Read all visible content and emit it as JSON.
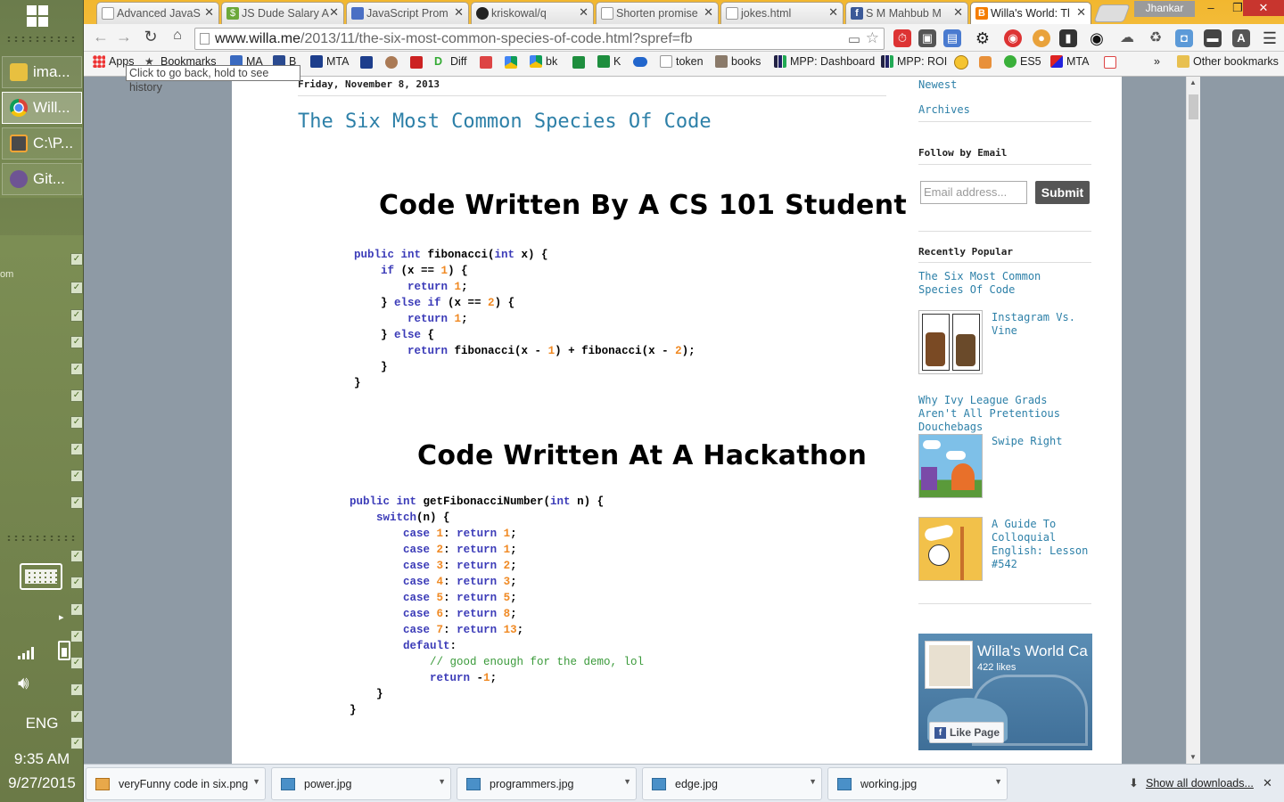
{
  "taskbar": {
    "buttons": [
      {
        "label": "ima...",
        "icon": "folder-icon"
      },
      {
        "label": "Will...",
        "icon": "chrome-icon"
      },
      {
        "label": "C:\\P...",
        "icon": "sublime-icon"
      },
      {
        "label": "Git...",
        "icon": "github-icon"
      }
    ],
    "side_text": "om",
    "language": "ENG",
    "time": "9:35 AM",
    "date": "9/27/2015"
  },
  "browser": {
    "tabs": [
      {
        "title": "Advanced JavaS",
        "icon": "page-icon"
      },
      {
        "title": "JS Dude Salary A",
        "icon": "dollar-icon"
      },
      {
        "title": "JavaScript Prom",
        "icon": "html5-icon"
      },
      {
        "title": "kriskowal/q",
        "icon": "github-icon"
      },
      {
        "title": "Shorten promise",
        "icon": "page-icon"
      },
      {
        "title": "jokes.html",
        "icon": "page-icon"
      },
      {
        "title": "S M Mahbub M",
        "icon": "facebook-icon"
      },
      {
        "title": "Willa's World: Tl",
        "icon": "blogger-icon",
        "active": true
      }
    ],
    "user": "Jhankar",
    "url_host": "www.willa.me",
    "url_path": "/2013/11/the-six-most-common-species-of-code.html?spref=fb",
    "tooltip": "Click to go back, hold to see history",
    "bookmarks": [
      {
        "label": "Apps",
        "icon": "apps-icon"
      },
      {
        "label": "Bookmarks",
        "icon": "star-icon"
      },
      {
        "label": "MA",
        "icon": "bookmark-icon"
      },
      {
        "label": "B",
        "icon": "bookmark-icon"
      },
      {
        "label": "MTA",
        "icon": "bookmark-icon"
      },
      {
        "label": "Diff",
        "icon": "bookmark-icon"
      },
      {
        "label": "bk",
        "icon": "drive-icon"
      },
      {
        "label": "K",
        "icon": "sheet-icon"
      },
      {
        "label": "token",
        "icon": "page-icon"
      },
      {
        "label": "books",
        "icon": "books-icon"
      },
      {
        "label": "MPP: Dashboard",
        "icon": "chart-icon"
      },
      {
        "label": "MPP: ROI",
        "icon": "chart-icon"
      },
      {
        "label": "ES5",
        "icon": "bookmark-icon"
      },
      {
        "label": "MTA",
        "icon": "bookmark-icon"
      }
    ],
    "other_bookmarks": "Other bookmarks",
    "overflow": "»"
  },
  "post": {
    "date": "Friday, November 8, 2013",
    "title": "The Six Most Common Species Of Code",
    "section1_heading": "Code Written By A CS 101 Student",
    "section2_heading": "Code Written At A Hackathon"
  },
  "sidebar": {
    "link_newest": "Newest",
    "link_archives": "Archives",
    "follow_heading": "Follow by Email",
    "email_placeholder": "Email address...",
    "submit_label": "Submit",
    "popular_heading": "Recently Popular",
    "popular": [
      "The Six Most Common Species Of Code",
      "Instagram Vs. Vine",
      "Why Ivy League Grads Aren't All Pretentious Douchebags",
      "Swipe Right",
      "A Guide To Colloquial English: Lesson #542"
    ],
    "fb_title": "Willa's World Ca",
    "fb_likes": "422 likes",
    "fb_like_button": "Like Page"
  },
  "downloads": {
    "items": [
      "veryFunny code in six.png",
      "power.jpg",
      "programmers.jpg",
      "edge.jpg",
      "working.jpg"
    ],
    "show_all": "Show all downloads..."
  }
}
